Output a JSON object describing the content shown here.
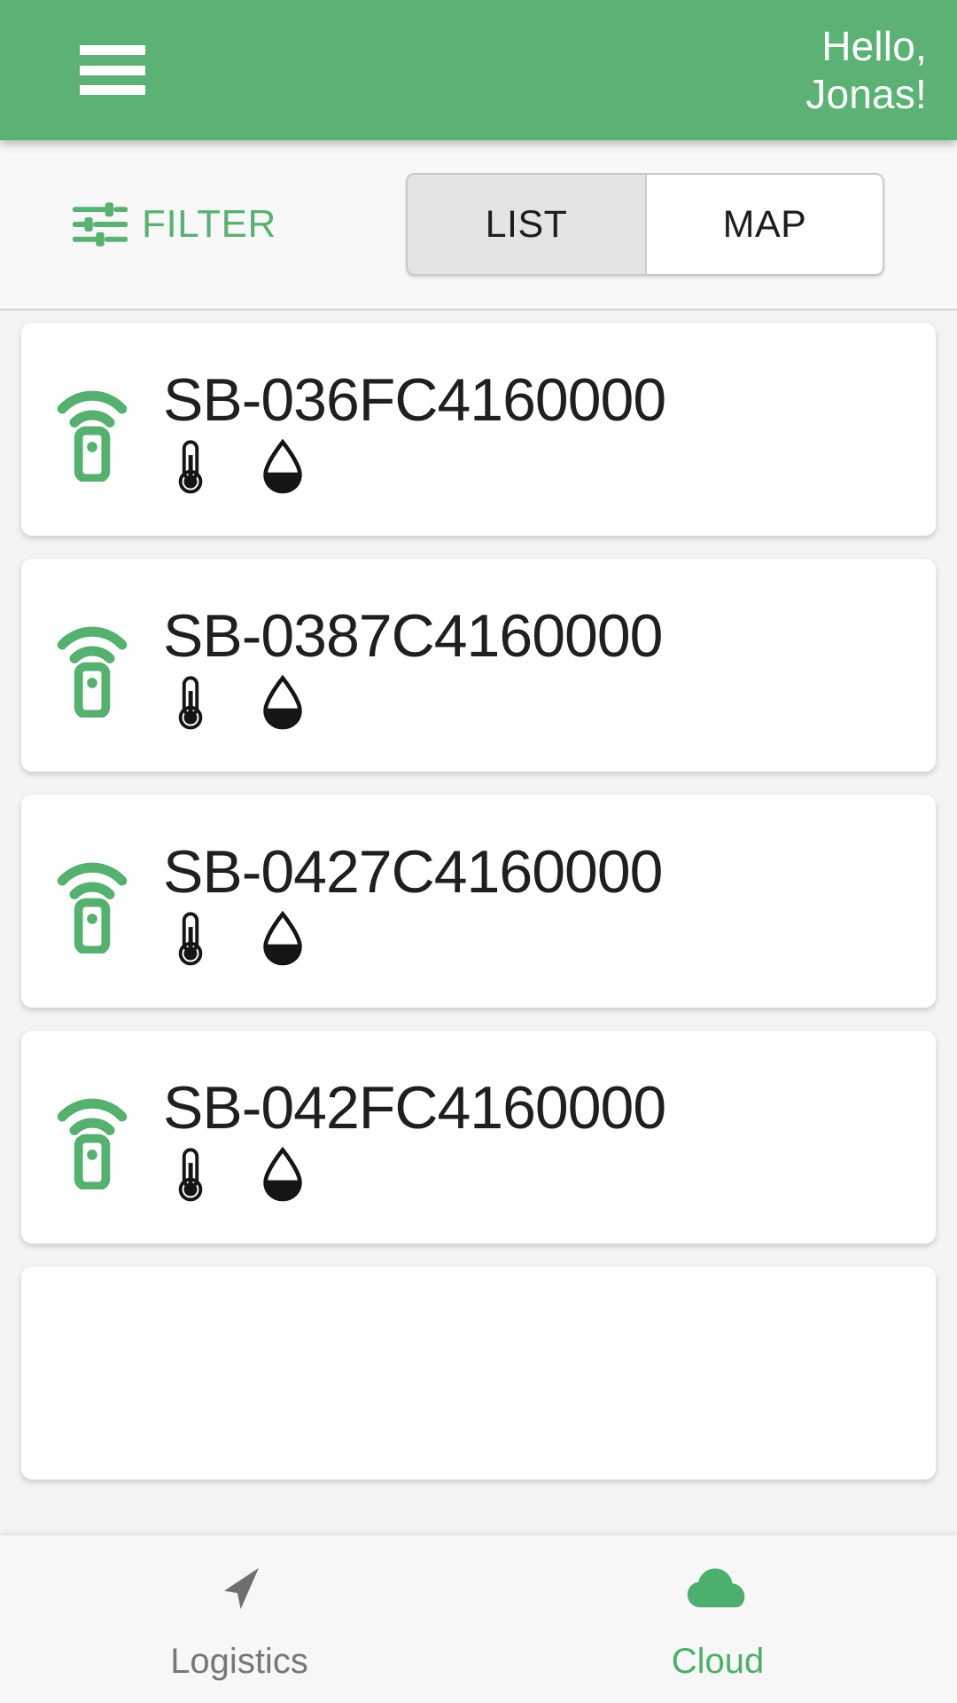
{
  "header": {
    "menu_icon": "hamburger-menu-icon",
    "greeting_line1": "Hello,",
    "greeting_line2": "Jonas!",
    "background_color": "#5BB274"
  },
  "toolbar": {
    "filter_icon": "sliders-filter-icon",
    "filter_label": "FILTER",
    "filter_color": "#59b173",
    "segments": [
      {
        "label": "LIST",
        "active": true
      },
      {
        "label": "MAP",
        "active": false
      }
    ]
  },
  "devices": [
    {
      "status_icon": "beacon-signal-icon",
      "name": "SB-036FC4160000",
      "sensors": [
        {
          "icon": "thermometer-icon",
          "label": "temperature"
        },
        {
          "icon": "humidity-droplet-icon",
          "label": "humidity"
        }
      ]
    },
    {
      "status_icon": "beacon-signal-icon",
      "name": "SB-0387C4160000",
      "sensors": [
        {
          "icon": "thermometer-icon",
          "label": "temperature"
        },
        {
          "icon": "humidity-droplet-icon",
          "label": "humidity"
        }
      ]
    },
    {
      "status_icon": "beacon-signal-icon",
      "name": "SB-0427C4160000",
      "sensors": [
        {
          "icon": "thermometer-icon",
          "label": "temperature"
        },
        {
          "icon": "humidity-droplet-icon",
          "label": "humidity"
        }
      ]
    },
    {
      "status_icon": "beacon-signal-icon",
      "name": "SB-042FC4160000",
      "sensors": [
        {
          "icon": "thermometer-icon",
          "label": "temperature"
        },
        {
          "icon": "humidity-droplet-icon",
          "label": "humidity"
        }
      ]
    }
  ],
  "bottom_nav": {
    "items": [
      {
        "icon": "navigation-arrow-icon",
        "label": "Logistics",
        "active": false,
        "color": "#777777"
      },
      {
        "icon": "cloud-icon",
        "label": "Cloud",
        "active": true,
        "color": "#4caf6d"
      }
    ]
  },
  "colors": {
    "brand_green": "#5BB274",
    "accent_green": "#4caf6d",
    "card_background": "#ffffff",
    "page_background": "#f4f4f4"
  }
}
